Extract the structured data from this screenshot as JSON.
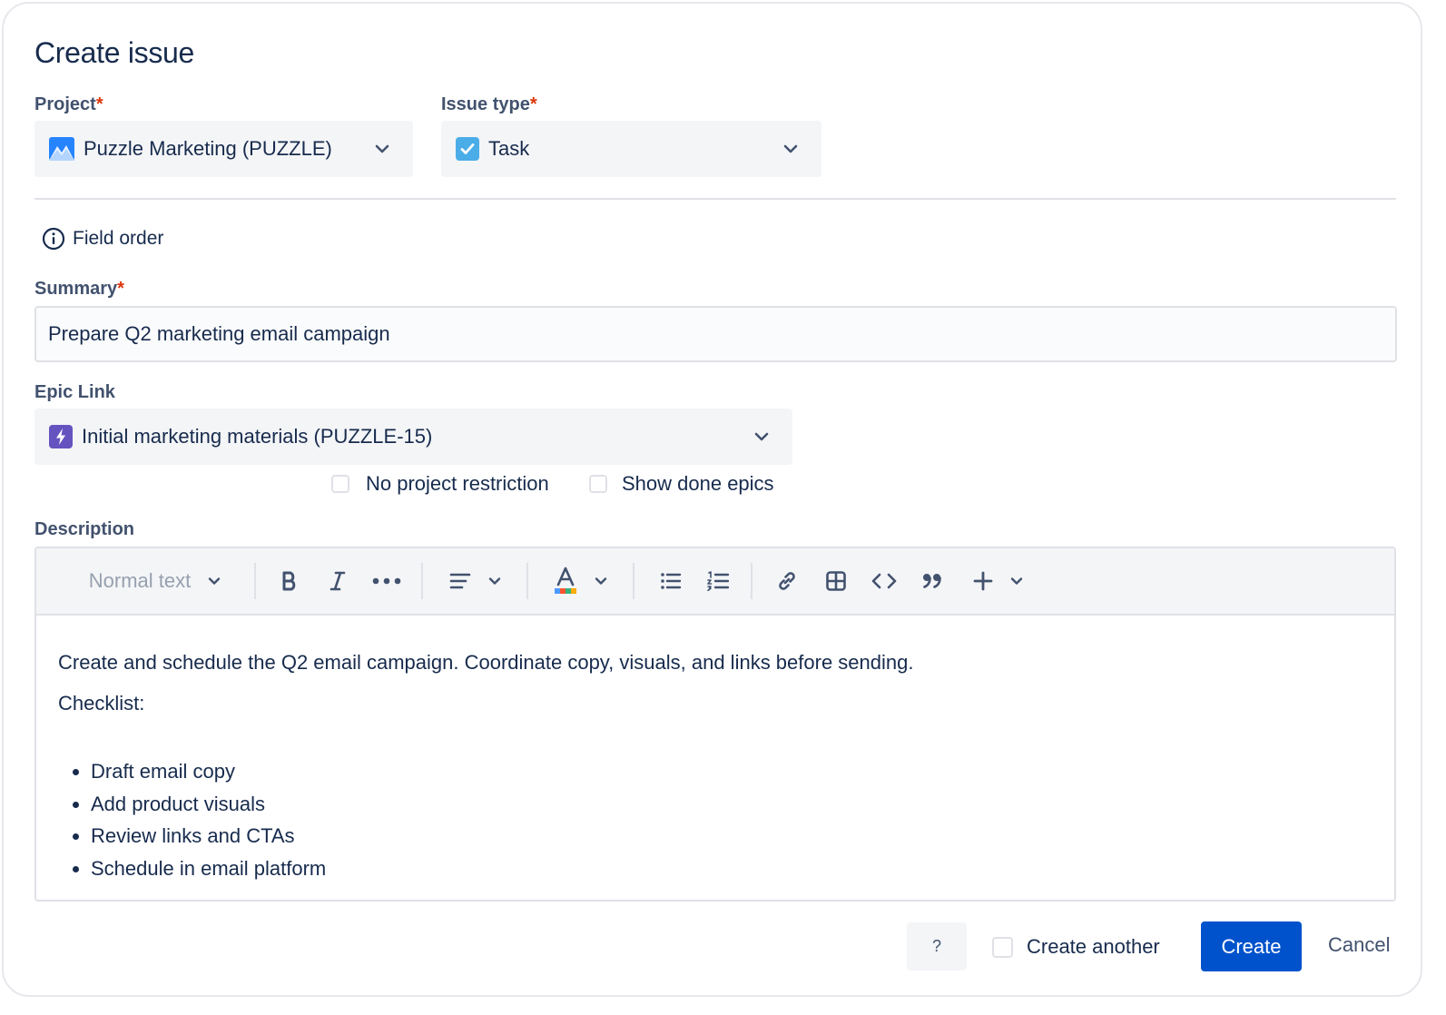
{
  "dialog": {
    "title": "Create issue"
  },
  "project": {
    "label": "Project",
    "required_mark": "*",
    "value": "Puzzle Marketing (PUZZLE)",
    "icon": "project-mountain-icon"
  },
  "issue_type": {
    "label": "Issue type",
    "required_mark": "*",
    "value": "Task",
    "icon": "task-checkbox-icon"
  },
  "field_order": {
    "label": "Field order",
    "icon": "info-icon"
  },
  "summary": {
    "label": "Summary",
    "required_mark": "*",
    "value": "Prepare Q2 marketing email campaign"
  },
  "epic_link": {
    "label": "Epic Link",
    "value": "Initial marketing materials (PUZZLE-15)",
    "icon": "epic-lightning-icon",
    "no_project_restriction": "No project restriction",
    "show_done_epics": "Show done epics"
  },
  "description": {
    "label": "Description",
    "toolbar": {
      "text_style": "Normal text",
      "buttons": [
        "bold-icon",
        "italic-icon",
        "more-icon",
        "align-icon",
        "text-color-icon",
        "bullet-list-icon",
        "numbered-list-icon",
        "link-icon",
        "table-icon",
        "code-icon",
        "quote-icon",
        "plus-icon"
      ]
    },
    "intro": "Create and schedule the Q2 email campaign. Coordinate copy, visuals, and links before sending.",
    "checklist_heading": "Checklist:",
    "checklist": [
      "Draft email copy",
      "Add product visuals",
      "Review links and CTAs",
      "Schedule in email platform"
    ]
  },
  "footer": {
    "help": "?",
    "create_another": "Create another",
    "create": "Create",
    "cancel": "Cancel"
  },
  "colors": {
    "primary": "#0052cc",
    "required": "#de350b",
    "epic": "#6554c0",
    "task": "#4bade8"
  }
}
